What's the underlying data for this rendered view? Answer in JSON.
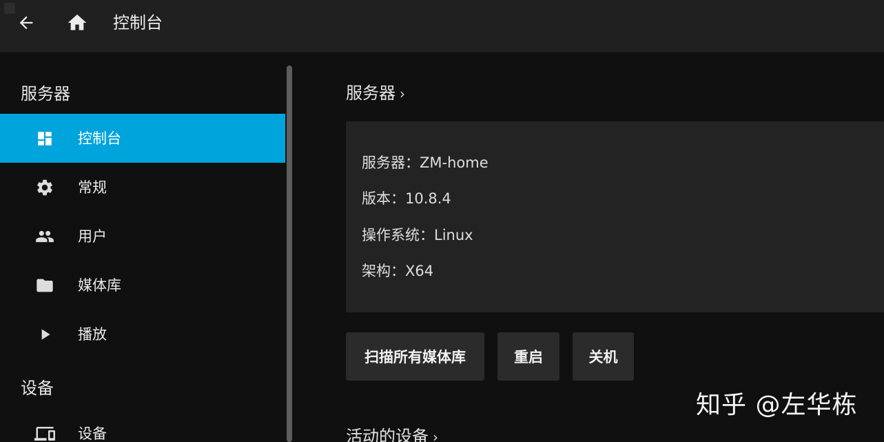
{
  "header": {
    "title": "控制台",
    "back_icon": "arrow-back-icon",
    "home_icon": "home-icon"
  },
  "sidebar": {
    "sections": [
      {
        "heading": "服务器",
        "items": [
          {
            "label": "控制台",
            "icon": "dashboard-icon",
            "active": true
          },
          {
            "label": "常规",
            "icon": "gear-icon",
            "active": false
          },
          {
            "label": "用户",
            "icon": "people-icon",
            "active": false
          },
          {
            "label": "媒体库",
            "icon": "folder-icon",
            "active": false
          },
          {
            "label": "播放",
            "icon": "play-icon",
            "active": false
          }
        ]
      },
      {
        "heading": "设备",
        "items": [
          {
            "label": "设备",
            "icon": "devices-icon",
            "active": false
          }
        ]
      }
    ]
  },
  "main": {
    "server_section": {
      "title": "服务器",
      "chevron": "›",
      "info": {
        "server": "服务器：ZM-home",
        "version": "版本：10.8.4",
        "os": "操作系统：Linux",
        "arch": "架构：X64"
      }
    },
    "buttons": {
      "scan_all": "扫描所有媒体库",
      "restart": "重启",
      "shutdown": "关机"
    },
    "devices_section": {
      "title": "活动的设备",
      "chevron": "›"
    }
  },
  "watermark": "知乎 @左华栋",
  "colors": {
    "accent": "#00a4dc",
    "header_bg": "#202020",
    "page_bg": "#101010",
    "card_bg": "#232323",
    "button_bg": "#2b2b2b"
  }
}
